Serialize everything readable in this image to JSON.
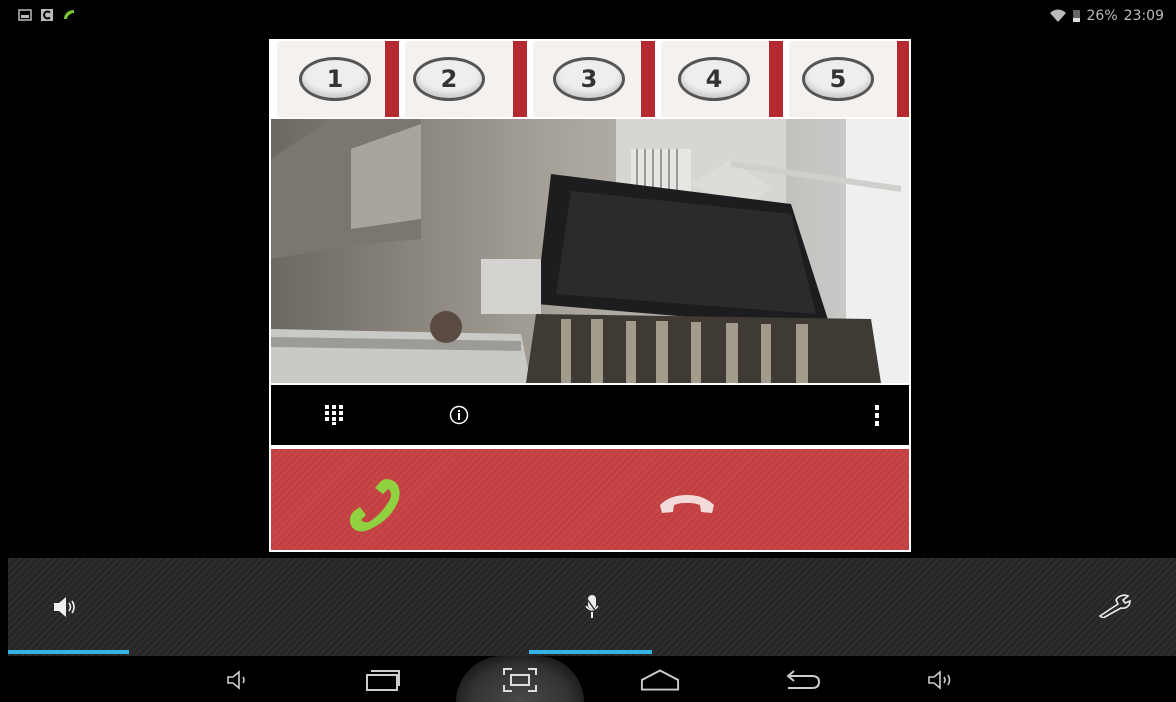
{
  "status_bar": {
    "left_icons": [
      "gallery-icon",
      "app-c-icon",
      "phone-icon"
    ],
    "battery_percent": "26%",
    "time": "23:09",
    "wifi_icon": "wifi-icon",
    "battery_icon": "battery-icon"
  },
  "intercom": {
    "buttons": [
      {
        "label": "1"
      },
      {
        "label": "2"
      },
      {
        "label": "3"
      },
      {
        "label": "4"
      },
      {
        "label": "5"
      }
    ],
    "toolbar": {
      "keypad_icon": "keypad-icon",
      "info_icon": "info-icon",
      "overflow_icon": "overflow-menu-icon"
    },
    "call": {
      "answer_icon": "answer-call-icon",
      "hangup_icon": "hang-up-icon",
      "answer_color": "#8fd13f",
      "hangup_color": "#f3dada"
    }
  },
  "controls": {
    "speaker_icon": "speaker-icon",
    "mic_icon": "microphone-icon",
    "settings_icon": "wrench-icon",
    "accent": "#33b5e5"
  },
  "navigation": {
    "buttons": [
      "volume-down-icon",
      "recent-apps-icon",
      "screenshot-icon",
      "home-icon",
      "back-icon",
      "volume-up-icon"
    ]
  }
}
